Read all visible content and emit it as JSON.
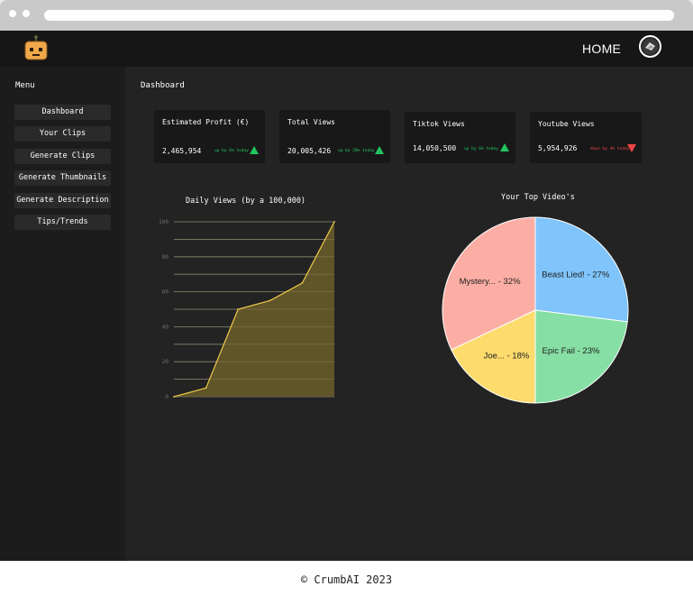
{
  "header": {
    "nav_home": "HOME",
    "logo_icon": "robot-logo-icon",
    "avatar_icon": "user-avatar-icon"
  },
  "sidebar": {
    "title": "Menu",
    "items": [
      {
        "label": "Dashboard"
      },
      {
        "label": "Your Clips"
      },
      {
        "label": "Generate Clips"
      },
      {
        "label": "Generate Thumbnails"
      },
      {
        "label": "Generate Description"
      },
      {
        "label": "Tips/Trends"
      }
    ]
  },
  "page": {
    "title": "Dashboard"
  },
  "cards": [
    {
      "label": "Estimated Profit (€)",
      "value": "2,465,954",
      "trend": "up by 6% today",
      "direction": "up"
    },
    {
      "label": "Total Views",
      "value": "20,005,426",
      "trend": "up by 20% today",
      "direction": "up"
    },
    {
      "label": "Tiktok Views",
      "value": "14,050,500",
      "trend": "up by 6% today",
      "direction": "up"
    },
    {
      "label": "Youtube Views",
      "value": "5,954,926",
      "trend": "down by 4% today",
      "direction": "down"
    }
  ],
  "colors": {
    "up": "#22c55e",
    "down": "#ef4444",
    "area_fill": "#6b5d2a",
    "area_line": "#f0c94a",
    "grid": "#8a8a8a"
  },
  "chart_data": [
    {
      "type": "area",
      "title": "Daily Views (by a 100,000)",
      "x": [
        0,
        1,
        2,
        3,
        4,
        5
      ],
      "values": [
        0,
        5,
        50,
        55,
        65,
        100
      ],
      "ylim": [
        0,
        100
      ],
      "yticks": [
        0,
        20,
        40,
        60,
        80,
        100
      ],
      "grid": true
    },
    {
      "type": "pie",
      "title": "Your Top Video's",
      "slices": [
        {
          "label": "Beast Lied! - 27%",
          "value": 27,
          "color": "#7fc4fb"
        },
        {
          "label": "Epic Fail - 23%",
          "value": 23,
          "color": "#86dfa4"
        },
        {
          "label": "Joe... - 18%",
          "value": 18,
          "color": "#fddb6d"
        },
        {
          "label": "Mystery... - 32%",
          "value": 32,
          "color": "#fdaea4"
        }
      ]
    }
  ],
  "footer": {
    "copyright": "© CrumbAI 2023"
  }
}
